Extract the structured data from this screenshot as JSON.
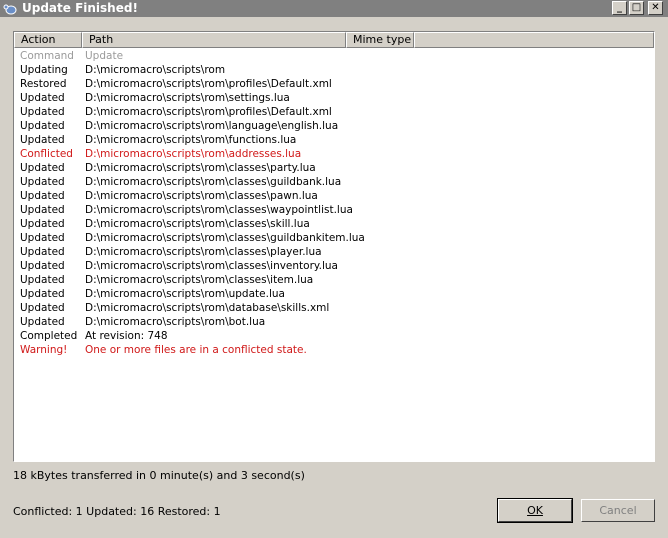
{
  "window": {
    "title": "Update Finished!"
  },
  "list": {
    "columns": [
      "Action",
      "Path",
      "Mime type"
    ],
    "rows": [
      {
        "action": "Command",
        "path": "Update",
        "style": "gray"
      },
      {
        "action": "Updating",
        "path": "D:\\micromacro\\scripts\\rom",
        "style": "normal"
      },
      {
        "action": "Restored",
        "path": "D:\\micromacro\\scripts\\rom\\profiles\\Default.xml",
        "style": "normal"
      },
      {
        "action": "Updated",
        "path": "D:\\micromacro\\scripts\\rom\\settings.lua",
        "style": "normal"
      },
      {
        "action": "Updated",
        "path": "D:\\micromacro\\scripts\\rom\\profiles\\Default.xml",
        "style": "normal"
      },
      {
        "action": "Updated",
        "path": "D:\\micromacro\\scripts\\rom\\language\\english.lua",
        "style": "normal"
      },
      {
        "action": "Updated",
        "path": "D:\\micromacro\\scripts\\rom\\functions.lua",
        "style": "normal"
      },
      {
        "action": "Conflicted",
        "path": "D:\\micromacro\\scripts\\rom\\addresses.lua",
        "style": "red"
      },
      {
        "action": "Updated",
        "path": "D:\\micromacro\\scripts\\rom\\classes\\party.lua",
        "style": "normal"
      },
      {
        "action": "Updated",
        "path": "D:\\micromacro\\scripts\\rom\\classes\\guildbank.lua",
        "style": "normal"
      },
      {
        "action": "Updated",
        "path": "D:\\micromacro\\scripts\\rom\\classes\\pawn.lua",
        "style": "normal"
      },
      {
        "action": "Updated",
        "path": "D:\\micromacro\\scripts\\rom\\classes\\waypointlist.lua",
        "style": "normal"
      },
      {
        "action": "Updated",
        "path": "D:\\micromacro\\scripts\\rom\\classes\\skill.lua",
        "style": "normal"
      },
      {
        "action": "Updated",
        "path": "D:\\micromacro\\scripts\\rom\\classes\\guildbankitem.lua",
        "style": "normal"
      },
      {
        "action": "Updated",
        "path": "D:\\micromacro\\scripts\\rom\\classes\\player.lua",
        "style": "normal"
      },
      {
        "action": "Updated",
        "path": "D:\\micromacro\\scripts\\rom\\classes\\inventory.lua",
        "style": "normal"
      },
      {
        "action": "Updated",
        "path": "D:\\micromacro\\scripts\\rom\\classes\\item.lua",
        "style": "normal"
      },
      {
        "action": "Updated",
        "path": "D:\\micromacro\\scripts\\rom\\update.lua",
        "style": "normal"
      },
      {
        "action": "Updated",
        "path": "D:\\micromacro\\scripts\\rom\\database\\skills.xml",
        "style": "normal"
      },
      {
        "action": "Updated",
        "path": "D:\\micromacro\\scripts\\rom\\bot.lua",
        "style": "normal"
      },
      {
        "action": "Completed",
        "path": "At revision: 748",
        "style": "normal"
      },
      {
        "action": "Warning!",
        "path": "One or more files are in a conflicted state.",
        "style": "red"
      }
    ]
  },
  "status": {
    "transfer": "18 kBytes transferred in 0 minute(s) and 3 second(s)"
  },
  "summary": {
    "text": "Conflicted: 1 Updated: 16 Restored: 1"
  },
  "buttons": {
    "ok": "OK",
    "cancel": "Cancel"
  },
  "colors": {
    "conflict": "#d01818",
    "muted": "#9a9a9a",
    "titlebar": "#808080"
  }
}
